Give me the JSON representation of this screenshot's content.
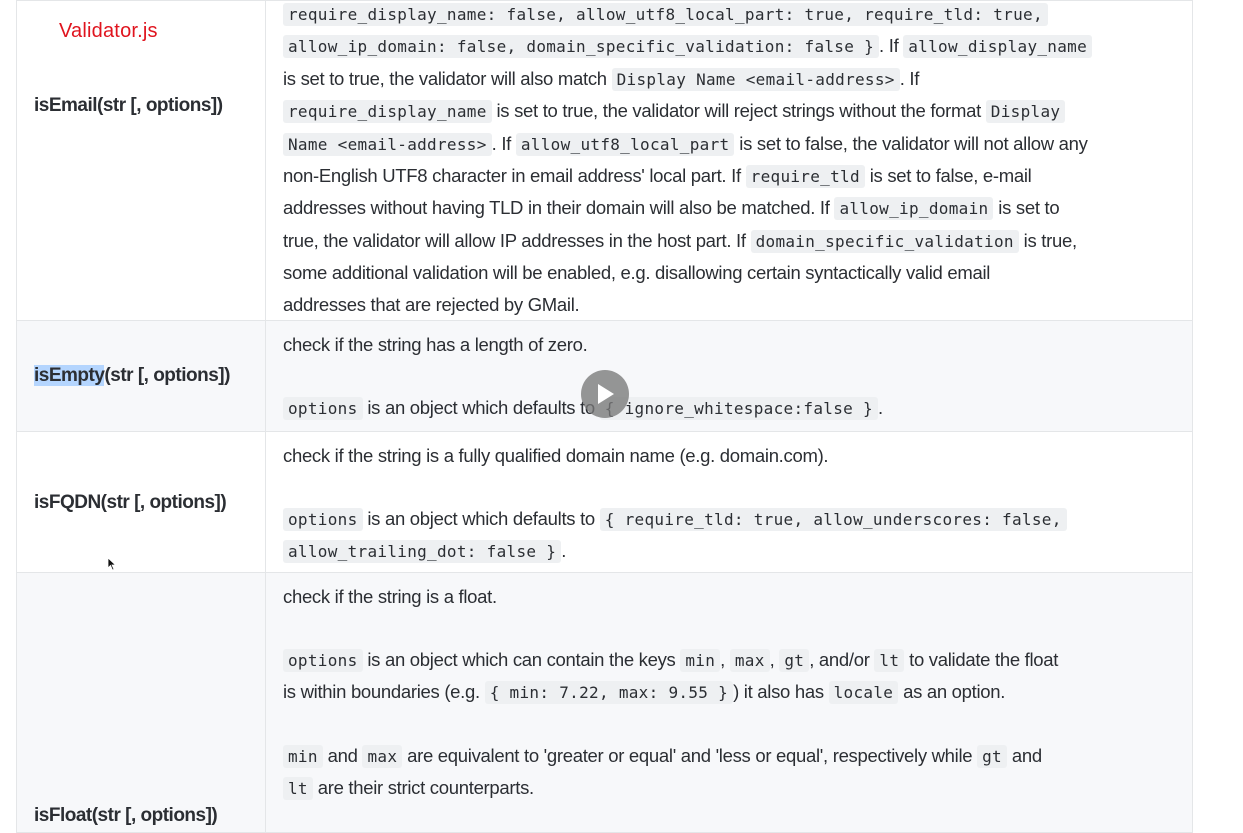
{
  "app": {
    "title": "Validator.js"
  },
  "icons": {
    "play": "play-icon",
    "cursor": "mouse-pointer-icon"
  },
  "colors": {
    "title": "#e0141e",
    "selection": "#b4d5fe"
  },
  "rows": [
    {
      "name": "isEmail(str [, options])",
      "desc": [
        {
          "t": "code",
          "v": "require_display_name: false, allow_utf8_local_part: true, require_tld: true,"
        },
        {
          "t": "br"
        },
        {
          "t": "code",
          "v": "allow_ip_domain: false, domain_specific_validation: false }"
        },
        {
          "t": "text",
          "v": ". If "
        },
        {
          "t": "code",
          "v": "allow_display_name"
        },
        {
          "t": "br"
        },
        {
          "t": "text",
          "v": "is set to true, the validator will also match "
        },
        {
          "t": "code",
          "v": "Display Name <email-address>"
        },
        {
          "t": "text",
          "v": ". If"
        },
        {
          "t": "br"
        },
        {
          "t": "code",
          "v": "require_display_name"
        },
        {
          "t": "text",
          "v": " is set to true, the validator will reject strings without the format "
        },
        {
          "t": "code",
          "v": "Display"
        },
        {
          "t": "br"
        },
        {
          "t": "code",
          "v": "Name <email-address>"
        },
        {
          "t": "text",
          "v": ". If "
        },
        {
          "t": "code",
          "v": "allow_utf8_local_part"
        },
        {
          "t": "text",
          "v": " is set to false, the validator will not allow any"
        },
        {
          "t": "br"
        },
        {
          "t": "text",
          "v": "non-English UTF8 character in email address' local part. If "
        },
        {
          "t": "code",
          "v": "require_tld"
        },
        {
          "t": "text",
          "v": " is set to false, e-mail"
        },
        {
          "t": "br"
        },
        {
          "t": "text",
          "v": "addresses without having TLD in their domain will also be matched. If "
        },
        {
          "t": "code",
          "v": "allow_ip_domain"
        },
        {
          "t": "text",
          "v": " is set to"
        },
        {
          "t": "br"
        },
        {
          "t": "text",
          "v": "true, the validator will allow IP addresses in the host part. If "
        },
        {
          "t": "code",
          "v": "domain_specific_validation"
        },
        {
          "t": "text",
          "v": " is true,"
        },
        {
          "t": "br"
        },
        {
          "t": "text",
          "v": "some additional validation will be enabled, e.g. disallowing certain syntactically valid email"
        },
        {
          "t": "br"
        },
        {
          "t": "text",
          "v": "addresses that are rejected by GMail."
        }
      ]
    },
    {
      "name_highlight": "isEmpty",
      "name_rest": "(str [, options])",
      "line1": "check if the string has a length of zero.",
      "p2": [
        {
          "t": "code",
          "v": "options"
        },
        {
          "t": "text",
          "v": " is an object which defaults to "
        },
        {
          "t": "code",
          "v": "{ ignore_whitespace:false }"
        },
        {
          "t": "text",
          "v": "."
        }
      ]
    },
    {
      "name": "isFQDN(str [, options])",
      "line1": "check if the string is a fully qualified domain name (e.g. domain.com).",
      "p2": [
        {
          "t": "code",
          "v": "options"
        },
        {
          "t": "text",
          "v": " is an object which defaults to "
        },
        {
          "t": "code",
          "v": "{ require_tld: true, allow_underscores: false,"
        },
        {
          "t": "br"
        },
        {
          "t": "code",
          "v": "allow_trailing_dot: false }"
        },
        {
          "t": "text",
          "v": "."
        }
      ]
    },
    {
      "name": "isFloat(str [, options])",
      "line1": "check if the string is a float.",
      "p2": [
        {
          "t": "code",
          "v": "options"
        },
        {
          "t": "text",
          "v": " is an object which can contain the keys "
        },
        {
          "t": "code",
          "v": "min"
        },
        {
          "t": "text",
          "v": ", "
        },
        {
          "t": "code",
          "v": "max"
        },
        {
          "t": "text",
          "v": ", "
        },
        {
          "t": "code",
          "v": "gt"
        },
        {
          "t": "text",
          "v": ", and/or "
        },
        {
          "t": "code",
          "v": "lt"
        },
        {
          "t": "text",
          "v": " to validate the float"
        },
        {
          "t": "br"
        },
        {
          "t": "text",
          "v": "is within boundaries (e.g. "
        },
        {
          "t": "code",
          "v": "{ min: 7.22, max: 9.55 }"
        },
        {
          "t": "text",
          "v": ") it also has "
        },
        {
          "t": "code",
          "v": "locale"
        },
        {
          "t": "text",
          "v": " as an option."
        }
      ],
      "p3": [
        {
          "t": "code",
          "v": "min"
        },
        {
          "t": "text",
          "v": " and "
        },
        {
          "t": "code",
          "v": "max"
        },
        {
          "t": "text",
          "v": " are equivalent to 'greater or equal' and 'less or equal', respectively while "
        },
        {
          "t": "code",
          "v": "gt"
        },
        {
          "t": "text",
          "v": " and"
        },
        {
          "t": "br"
        },
        {
          "t": "code",
          "v": "lt"
        },
        {
          "t": "text",
          "v": " are their strict counterparts."
        }
      ]
    }
  ]
}
